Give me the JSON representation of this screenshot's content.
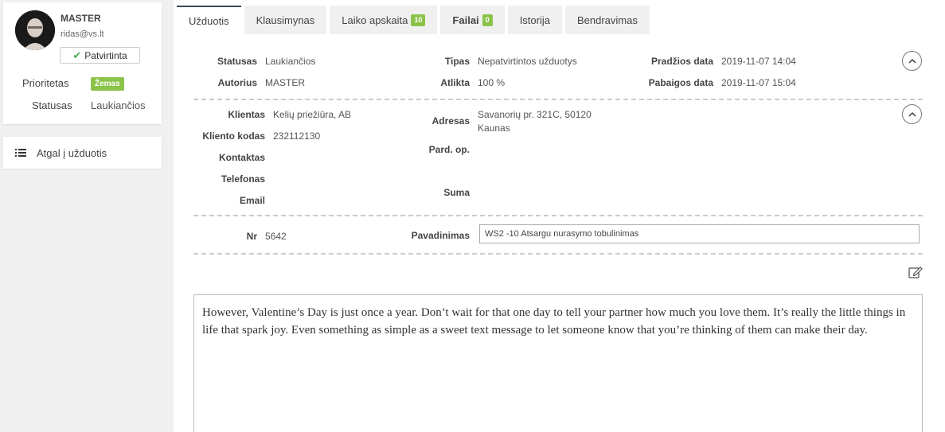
{
  "user": {
    "name": "MASTER",
    "email": "ridas@vs.lt",
    "verified_label": "Patvirtinta",
    "priority_label": "Prioritetas",
    "priority_value": "Žemas",
    "status_label": "Statusas",
    "status_value": "Laukiančios"
  },
  "nav": {
    "back_label": "Atgal į užduotis"
  },
  "tabs": [
    {
      "label": "Užduotis",
      "badge": null,
      "active": true
    },
    {
      "label": "Klausimynas",
      "badge": null
    },
    {
      "label": "Laiko apskaita",
      "badge": "10"
    },
    {
      "label": "Failai",
      "badge": "0"
    },
    {
      "label": "Istorija",
      "badge": null
    },
    {
      "label": "Bendravimas",
      "badge": null
    }
  ],
  "task": {
    "status_label": "Statusas",
    "status_value": "Laukiančios",
    "author_label": "Autorius",
    "author_value": "MASTER",
    "type_label": "Tipas",
    "type_value": "Nepatvirtintos užduotys",
    "done_label": "Atlikta",
    "done_value": "100 %",
    "start_label": "Pradžios data",
    "start_value": "2019-11-07 14:04",
    "end_label": "Pabaigos data",
    "end_value": "2019-11-07 15:04"
  },
  "client": {
    "client_label": "Klientas",
    "client_value": "Kelių priežiūra, AB",
    "code_label": "Kliento kodas",
    "code_value": "232112130",
    "contact_label": "Kontaktas",
    "phone_label": "Telefonas",
    "email_label": "Email",
    "address_label": "Adresas",
    "address_line1": "Savanorių pr. 321C, 50120",
    "address_line2": "Kaunas",
    "sales_label": "Pard. op.",
    "sum_label": "Suma"
  },
  "meta": {
    "nr_label": "Nr",
    "nr_value": "5642",
    "title_label": "Pavadinimas",
    "title_value": "WS2 -10 Atsargu nurasymo tobulinimas"
  },
  "description": "However, Valentine’s Day is just once a year. Don’t wait for that one day to tell your partner how much you love them. It’s really the little things in life that spark joy. Even something as simple as a sweet text message to let someone know that you’re thinking of them can make their day.",
  "colors": {
    "accent": "#8bc34a",
    "check": "#4caf50"
  },
  "icons": [
    "check-icon",
    "list-icon",
    "chevron-up-icon",
    "edit-icon"
  ]
}
